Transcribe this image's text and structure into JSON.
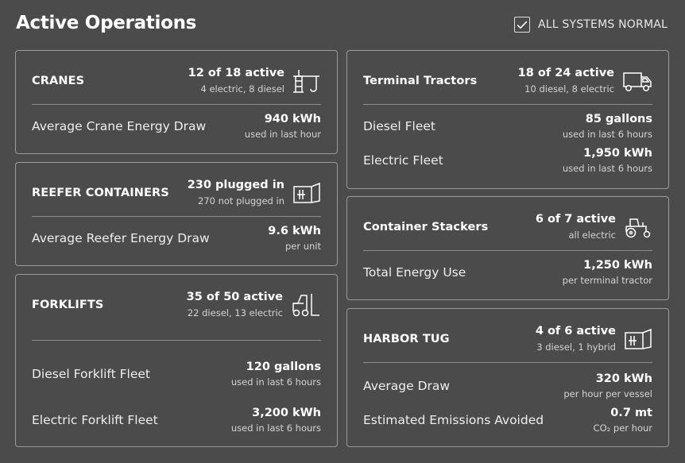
{
  "page": {
    "title": "Active Operations",
    "status_label": "ALL SYSTEMS NORMAL",
    "status_checked": true
  },
  "cards": {
    "cranes": {
      "title": "CRANES",
      "stat": "12 of 18 active",
      "stat_sub": "4 electric, 8 diesel",
      "icon": "crane-icon",
      "metrics": [
        {
          "label": "Average Crane Energy Draw",
          "value": "940 kWh",
          "sub": "used in last hour"
        }
      ]
    },
    "reefers": {
      "title": "REEFER CONTAINERS",
      "stat": "230 plugged in",
      "stat_sub": "270 not plugged in",
      "icon": "container-icon",
      "metrics": [
        {
          "label": "Average Reefer Energy Draw",
          "value": "9.6 kWh",
          "sub": "per unit"
        }
      ]
    },
    "forklifts": {
      "title": "FORKLIFTS",
      "stat": "35 of 50 active",
      "stat_sub": "22 diesel, 13 electric",
      "icon": "forklift-icon",
      "metrics": [
        {
          "label": "Diesel Forklift Fleet",
          "value": "120 gallons",
          "sub": "used in last 6 hours"
        },
        {
          "label": "Electric Forklift Fleet",
          "value": "3,200 kWh",
          "sub": "used in last 6 hours"
        }
      ]
    },
    "tractors": {
      "title": "Terminal Tractors",
      "stat": "18 of 24 active",
      "stat_sub": "10 diesel, 8 electric",
      "icon": "truck-icon",
      "metrics": [
        {
          "label": "Diesel Fleet",
          "value": "85 gallons",
          "sub": "used in last 6 hours"
        },
        {
          "label": "Electric Fleet",
          "value": "1,950 kWh",
          "sub": "used in last 6 hours"
        }
      ]
    },
    "stackers": {
      "title": "Container Stackers",
      "stat": "6 of 7 active",
      "stat_sub": "all electric",
      "icon": "tractor-icon",
      "metrics": [
        {
          "label": "Total Energy Use",
          "value": "1,250 kWh",
          "sub": "per terminal tractor"
        }
      ]
    },
    "tug": {
      "title": "HARBOR TUG",
      "stat": "4 of 6 active",
      "stat_sub": "3 diesel, 1 hybrid",
      "icon": "container-icon",
      "metrics": [
        {
          "label": "Average Draw",
          "value": "320 kWh",
          "sub": "per hour per vessel"
        },
        {
          "label": "Estimated Emissions Avoided",
          "value": "0.7 mt",
          "sub": "CO₂ per hour"
        }
      ]
    }
  }
}
